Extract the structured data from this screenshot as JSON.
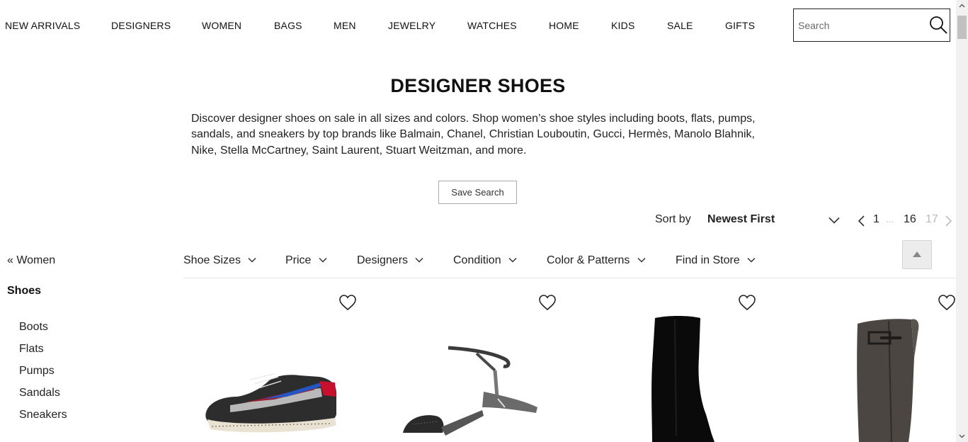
{
  "nav": {
    "items": [
      "NEW ARRIVALS",
      "DESIGNERS",
      "WOMEN",
      "BAGS",
      "MEN",
      "JEWELRY",
      "WATCHES",
      "HOME",
      "KIDS",
      "SALE",
      "GIFTS"
    ]
  },
  "search": {
    "placeholder": "Search"
  },
  "header": {
    "title": "DESIGNER SHOES",
    "description": "Discover designer shoes on sale in all sizes and colors. Shop women’s shoe styles including boots, flats, pumps, sandals, and sneakers by top brands like Balmain, Chanel, Christian Louboutin, Gucci, Hermès, Manolo Blahnik, Nike, Stella McCartney, Saint Laurent, Stuart Weitzman, and more.",
    "save_search": "Save Search"
  },
  "sort": {
    "label": "Sort by",
    "value": "Newest First"
  },
  "pagination": {
    "first": "1",
    "ellipsis": "...",
    "current": "16",
    "last": "17"
  },
  "sidebar": {
    "back": "« Women",
    "heading": "Shoes",
    "items": [
      "Boots",
      "Flats",
      "Pumps",
      "Sandals",
      "Sneakers"
    ]
  },
  "filters": [
    "Shoe Sizes",
    "Price",
    "Designers",
    "Condition",
    "Color & Patterns",
    "Find in Store"
  ],
  "products": [
    {
      "icon": "sneaker-image"
    },
    {
      "icon": "sandal-image"
    },
    {
      "icon": "suede-boot-image"
    },
    {
      "icon": "leather-boot-image"
    }
  ],
  "colors": {
    "text": "#111111",
    "border": "#222222",
    "muted": "#bbbbbb"
  }
}
